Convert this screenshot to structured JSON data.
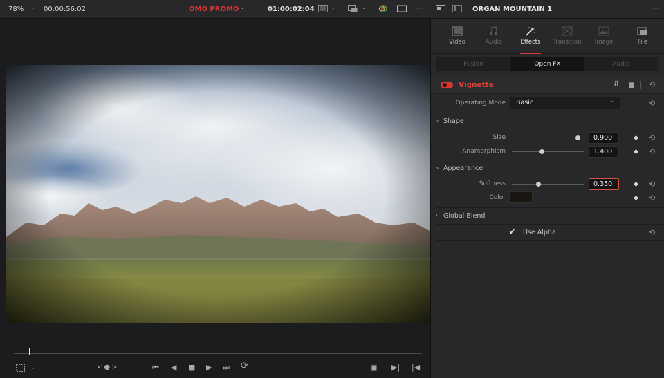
{
  "topbar": {
    "zoom": "78%",
    "source_timecode": "00:00:56:02",
    "timeline_name": "OMO PROMO",
    "record_timecode": "01:00:02:04",
    "clip_name": "ORGAN MOUNTAIN 1",
    "more": "•••",
    "accent_color": "#d7352f"
  },
  "inspector": {
    "tabs": [
      {
        "label": "Video",
        "icon": "video-icon",
        "state": "enabled"
      },
      {
        "label": "Audio",
        "icon": "audio-icon",
        "state": "disabled"
      },
      {
        "label": "Effects",
        "icon": "effects-wand-icon",
        "state": "active"
      },
      {
        "label": "Transition",
        "icon": "transition-icon",
        "state": "disabled"
      },
      {
        "label": "Image",
        "icon": "image-icon",
        "state": "disabled"
      },
      {
        "label": "File",
        "icon": "file-icon",
        "state": "enabled"
      }
    ],
    "subtabs": [
      "Fusion",
      "Open FX",
      "Audio"
    ],
    "active_subtab": "Open FX",
    "effect": {
      "name": "Vignette",
      "name_color": "#e0413a",
      "operating_mode_label": "Operating Mode",
      "operating_mode_value": "Basic",
      "shape_label": "Shape",
      "size_label": "Size",
      "size_value": "0.900",
      "anamorphism_label": "Anamorphism",
      "anamorphism_value": "1.400",
      "appearance_label": "Appearance",
      "softness_label": "Softness",
      "softness_value": "0.350",
      "color_label": "Color",
      "color_swatch": "#1a1612",
      "global_blend_label": "Global Blend",
      "use_alpha_label": "Use Alpha",
      "use_alpha_checked": true
    }
  }
}
